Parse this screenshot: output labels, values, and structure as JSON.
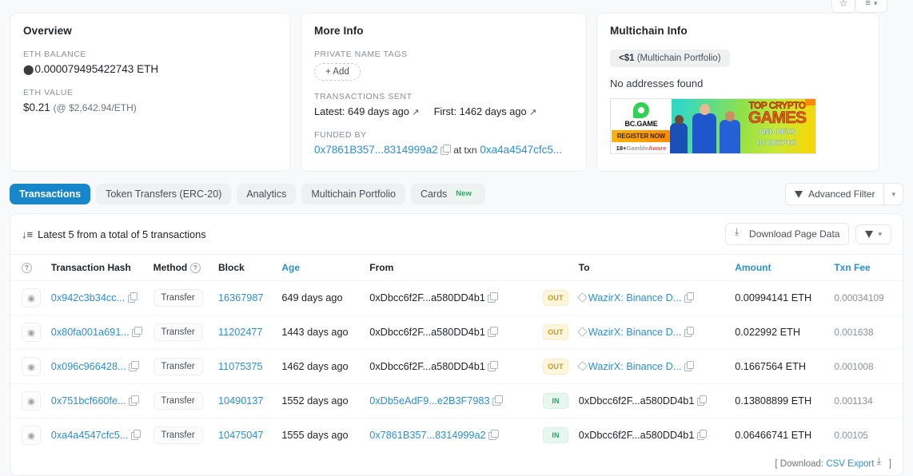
{
  "topbar": {
    "star_icon": "star-outline-icon",
    "list_icon": "list-icon"
  },
  "overview": {
    "title": "Overview",
    "eth_balance_label": "ETH BALANCE",
    "eth_balance": "0.000079495422743 ETH",
    "eth_value_label": "ETH VALUE",
    "eth_value": "$0.21",
    "eth_rate": "(@ $2,642.94/ETH)"
  },
  "more_info": {
    "title": "More Info",
    "private_name_tags_label": "PRIVATE NAME TAGS",
    "add_button": "+ Add",
    "transactions_sent_label": "TRANSACTIONS SENT",
    "latest": "Latest: 649 days ago",
    "first": "First: 1462 days ago",
    "funded_by_label": "FUNDED BY",
    "funded_address": "0x7861B357...8314999a2",
    "funded_at_txn_prefix": "at txn",
    "funded_txn": "0xa4a4547cfc5..."
  },
  "multichain": {
    "title": "Multichain Info",
    "portfolio_chip_value": "<$1",
    "portfolio_chip_label": "(Multichain Portfolio)",
    "no_addresses": "No addresses found",
    "ad": {
      "brand": "BC.GAME",
      "cta": "REGISTER NOW",
      "age_rating": "18+",
      "gamble": "Gamble",
      "aware": "Aware",
      "line1": "TOP CRYPTO",
      "line2": "GAMES",
      "line3": "AND BETS",
      "line4": "IN CRYPTO"
    }
  },
  "tabs": [
    {
      "label": "Transactions",
      "active": true
    },
    {
      "label": "Token Transfers (ERC-20)",
      "active": false
    },
    {
      "label": "Analytics",
      "active": false
    },
    {
      "label": "Multichain Portfolio",
      "active": false
    },
    {
      "label": "Cards",
      "active": false,
      "badge": "New"
    }
  ],
  "advanced_filter": {
    "label": "Advanced Filter",
    "caret": "⌄"
  },
  "table_toolbar": {
    "count_text": "Latest 5 from a total of 5 transactions",
    "download_label": "Download Page Data"
  },
  "columns": {
    "hash": "Transaction Hash",
    "method": "Method",
    "block": "Block",
    "age": "Age",
    "from": "From",
    "to": "To",
    "amount": "Amount",
    "txn_fee": "Txn Fee"
  },
  "rows": [
    {
      "hash": "0x942c3b34cc...",
      "method": "Transfer",
      "block": "16367987",
      "age": "649 days ago",
      "from": "0xDbcc6f2F...a580DD4b1",
      "from_is_link": false,
      "direction": "OUT",
      "to": "WazirX: Binance D...",
      "to_is_link": true,
      "to_has_diamond": true,
      "amount": "0.00994141 ETH",
      "fee": "0.00034109"
    },
    {
      "hash": "0x80fa001a691...",
      "method": "Transfer",
      "block": "11202477",
      "age": "1443 days ago",
      "from": "0xDbcc6f2F...a580DD4b1",
      "from_is_link": false,
      "direction": "OUT",
      "to": "WazirX: Binance D...",
      "to_is_link": true,
      "to_has_diamond": true,
      "amount": "0.022992 ETH",
      "fee": "0.001638"
    },
    {
      "hash": "0x096c966428...",
      "method": "Transfer",
      "block": "11075375",
      "age": "1462 days ago",
      "from": "0xDbcc6f2F...a580DD4b1",
      "from_is_link": false,
      "direction": "OUT",
      "to": "WazirX: Binance D...",
      "to_is_link": true,
      "to_has_diamond": true,
      "amount": "0.1667564 ETH",
      "fee": "0.001008"
    },
    {
      "hash": "0x751bcf660fe...",
      "method": "Transfer",
      "block": "10490137",
      "age": "1552 days ago",
      "from": "0xDb5eAdF9...e2B3F7983",
      "from_is_link": true,
      "direction": "IN",
      "to": "0xDbcc6f2F...a580DD4b1",
      "to_is_link": false,
      "to_has_diamond": false,
      "amount": "0.13808899 ETH",
      "fee": "0.001134"
    },
    {
      "hash": "0xa4a4547cfc5...",
      "method": "Transfer",
      "block": "10475047",
      "age": "1555 days ago",
      "from": "0x7861B357...8314999a2",
      "from_is_link": true,
      "direction": "IN",
      "to": "0xDbcc6f2F...a580DD4b1",
      "to_is_link": false,
      "to_has_diamond": false,
      "amount": "0.06466741 ETH",
      "fee": "0.00105"
    }
  ],
  "footer": {
    "prefix": "[ Download:",
    "link": "CSV Export",
    "suffix": "]"
  },
  "colors": {
    "accent_blue": "#1787c9",
    "link_blue": "#2c8fd6",
    "out_badge_bg": "#fdf6dd",
    "out_badge_fg": "#c79a1e",
    "in_badge_bg": "#e6f7f0",
    "in_badge_fg": "#2e9e73",
    "new_badge_fg": "#29a76a"
  }
}
